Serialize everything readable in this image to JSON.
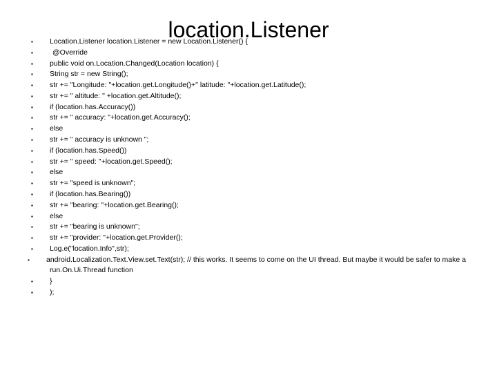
{
  "slide": {
    "title": "location.Listener",
    "bullet_glyph": "▪",
    "background_color": "#ffffff",
    "text_color": "#000000",
    "lines": [
      {
        "text": "Location.Listener location.Listener = new Location.Listener() {",
        "indent": 0
      },
      {
        "text": "@Override",
        "indent": 1
      },
      {
        "text": "public void on.Location.Changed(Location location) {",
        "indent": 2
      },
      {
        "text": "String str = new String();",
        "indent": 2
      },
      {
        "text": "str += \"Longitude: \"+location.get.Longitude()+\" latitude: \"+location.get.Latitude();",
        "indent": 2
      },
      {
        "text": "str += \" altitude: \" +location.get.Altitude();",
        "indent": 2
      },
      {
        "text": "if (location.has.Accuracy())",
        "indent": 2
      },
      {
        "text": "str += \" accuracy: \"+location.get.Accuracy();",
        "indent": 2
      },
      {
        "text": "else",
        "indent": 2
      },
      {
        "text": "str += \" accuracy is unknown \";",
        "indent": 2
      },
      {
        "text": "if (location.has.Speed())",
        "indent": 2
      },
      {
        "text": "str += \" speed: \"+location.get.Speed();",
        "indent": 2
      },
      {
        "text": "else",
        "indent": 2
      },
      {
        "text": "str += \"speed is unknown\";",
        "indent": 2
      },
      {
        "text": "if (location.has.Bearing())",
        "indent": 2
      },
      {
        "text": "str += \"bearing: \"+location.get.Bearing();",
        "indent": 2
      },
      {
        "text": "else",
        "indent": 2
      },
      {
        "text": "str += \"bearing is unknown\";",
        "indent": 2
      },
      {
        "text": "str += \"provider: \"+location.get.Provider();",
        "indent": 2
      },
      {
        "text": "Log.e(\"location.Info\",str);",
        "indent": 2
      },
      {
        "text": "android.Localization.Text.View.set.Text(str); // this works. It seems to come on the UI thread. But maybe it would be safer to make a run.On.Ui.Thread function",
        "indent": 3
      },
      {
        "text": "}",
        "indent": 2
      },
      {
        "text": ");",
        "indent": 2
      }
    ]
  }
}
